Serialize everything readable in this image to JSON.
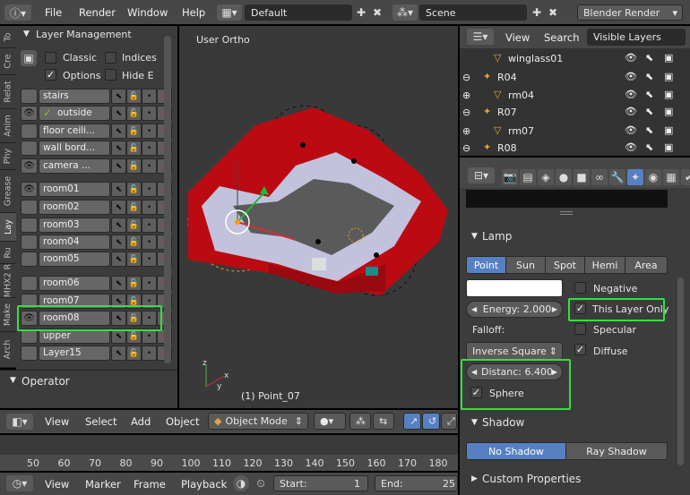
{
  "top_menu": {
    "file": "File",
    "render": "Render",
    "window": "Window",
    "help": "Help",
    "layout": "Default",
    "scene": "Scene",
    "engine": "Blender Render"
  },
  "side_tabs": [
    "To",
    "Cre",
    "Relat",
    "Anim",
    "Phy",
    "Grease",
    "Lay",
    "Ru",
    "MHX2 R",
    "Make",
    "Arch"
  ],
  "layer_panel": {
    "title": "Layer Management",
    "classic": "Classic",
    "indices": "Indices",
    "options": "Options",
    "hide": "Hide E",
    "layers": [
      "stairs",
      "outside",
      "floor ceili...",
      "wall bord...",
      "camera ...",
      "room01",
      "room02",
      "room03",
      "room04",
      "room05",
      "room06",
      "room07",
      "room08",
      "upper",
      "Layer15"
    ]
  },
  "operator_title": "Operator",
  "viewport": {
    "label": "User Ortho",
    "object": "(1) Point_07"
  },
  "view_header": {
    "view": "View",
    "select": "Select",
    "add": "Add",
    "object": "Object",
    "mode": "Object Mode"
  },
  "timeline": {
    "ticks": [
      "50",
      "60",
      "70",
      "80",
      "90",
      "100",
      "110",
      "120",
      "130",
      "140",
      "150",
      "160",
      "170",
      "180"
    ],
    "view": "View",
    "marker": "Marker",
    "frame": "Frame",
    "playback": "Playback",
    "start": "Start:",
    "start_val": "1",
    "end": "End:",
    "end_val": "25"
  },
  "outliner": {
    "view": "View",
    "search": "Search",
    "filter": "Visible Layers",
    "items": [
      "winglass01",
      "R04",
      "rm04",
      "R07",
      "rm07",
      "R08"
    ]
  },
  "lamp": {
    "panel": "Lamp",
    "types": [
      "Point",
      "Sun",
      "Spot",
      "Hemi",
      "Area"
    ],
    "negative": "Negative",
    "energy": "Energy:",
    "energy_val": "2.000",
    "this_layer": "This Layer Only",
    "falloff": "Falloff:",
    "specular": "Specular",
    "falloff_type": "Inverse Square",
    "diffuse": "Diffuse",
    "distance": "Distanc:",
    "distance_val": "6.400",
    "sphere": "Sphere"
  },
  "shadow": {
    "panel": "Shadow",
    "no_shadow": "No Shadow",
    "ray_shadow": "Ray Shadow"
  },
  "custom_props": "Custom Properties"
}
